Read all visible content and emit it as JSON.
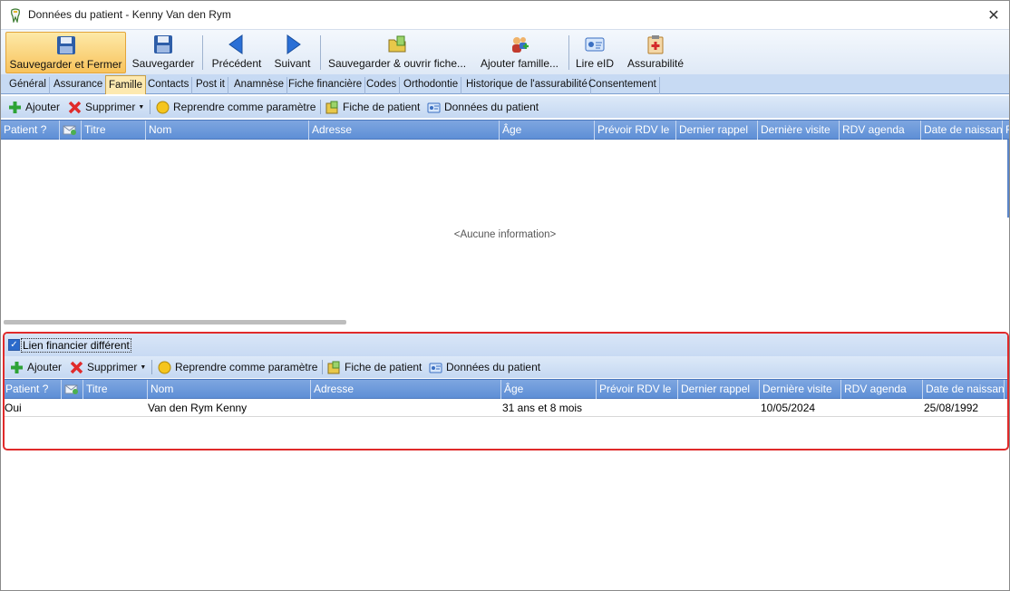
{
  "window": {
    "title": "Données du patient - Kenny Van den Rym",
    "close_glyph": "✕"
  },
  "toolbar": {
    "save_close": "Sauvegarder et Fermer",
    "save": "Sauvegarder",
    "previous": "Précédent",
    "next": "Suivant",
    "save_open": "Sauvegarder & ouvrir fiche...",
    "add_family": "Ajouter famille...",
    "read_eid": "Lire eID",
    "insurability": "Assurabilité"
  },
  "tabs": [
    "Général",
    "Assurance",
    "Famille",
    "Contacts",
    "Post it",
    "Anamnèse",
    "Fiche financière",
    "Codes",
    "Orthodontie",
    "Historique de l'assurabilité",
    "Consentement"
  ],
  "actions": {
    "add": "Ajouter",
    "delete": "Supprimer",
    "reuse_param": "Reprendre comme paramètre",
    "patient_card": "Fiche de patient",
    "patient_data": "Données du patient"
  },
  "columns": [
    "Patient ?",
    "",
    "Titre",
    "Nom",
    "Adresse",
    "Âge",
    "Prévoir RDV le",
    "Dernier rappel",
    "Dernière visite",
    "RDV agenda",
    "Date de naissance",
    "F"
  ],
  "upper_grid": {
    "empty_message": "<Aucune information>"
  },
  "lower_section": {
    "checkbox_label": "Lien financier différent",
    "checkbox_checked": true,
    "checkbox_glyph": "✓",
    "rows": [
      {
        "patient": "Oui",
        "title": "",
        "name": "Van den Rym Kenny",
        "address": "",
        "age": "31 ans et 8 mois",
        "plan_rdv": "",
        "last_reminder": "",
        "last_visit": "10/05/2024",
        "rdv_agenda": "",
        "birth_date": "25/08/1992"
      }
    ]
  },
  "colors": {
    "header_blue": "#6a98da",
    "active_tab": "#fde9b0",
    "highlight_border": "#e02a2a"
  }
}
